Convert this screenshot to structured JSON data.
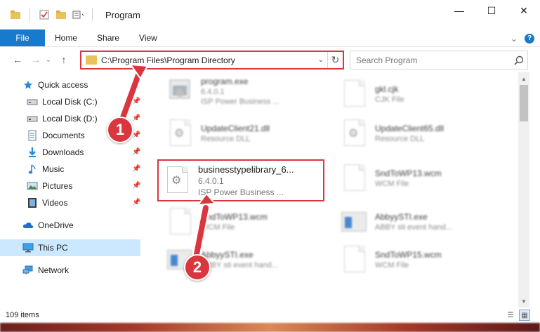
{
  "window": {
    "title": "Program",
    "minimize": "—",
    "maximize": "☐",
    "close": "✕"
  },
  "ribbon": {
    "tabs": [
      "File",
      "Home",
      "Share",
      "View"
    ],
    "help": "?",
    "collapse": "⌄"
  },
  "nav": {
    "back": "←",
    "forward": "→",
    "recent": "⌄",
    "up": "↑",
    "address": "C:\\Program Files\\Program Directory",
    "address_drop": "⌄",
    "refresh": "↻",
    "search_placeholder": "Search Program"
  },
  "sidebar": {
    "items": [
      {
        "label": "Quick access",
        "icon": "star-icon",
        "pin": false
      },
      {
        "label": "Local Disk (C:)",
        "icon": "drive-icon",
        "pin": true
      },
      {
        "label": "Local Disk (D:)",
        "icon": "drive-icon",
        "pin": true
      },
      {
        "label": "Documents",
        "icon": "documents-icon",
        "pin": true
      },
      {
        "label": "Downloads",
        "icon": "download-icon",
        "pin": true
      },
      {
        "label": "Music",
        "icon": "music-icon",
        "pin": true
      },
      {
        "label": "Pictures",
        "icon": "pictures-icon",
        "pin": true
      },
      {
        "label": "Videos",
        "icon": "videos-icon",
        "pin": true
      },
      {
        "label": "OneDrive",
        "icon": "cloud-icon",
        "pin": false
      },
      {
        "label": "This PC",
        "icon": "computer-icon",
        "pin": false,
        "selected": true
      },
      {
        "label": "Network",
        "icon": "network-icon",
        "pin": false
      }
    ]
  },
  "files": [
    {
      "name": "program.exe",
      "line2": "6.4.0.1",
      "line3": "ISP Power Business ...",
      "icon": "exe-icon"
    },
    {
      "name": "gkl.cjk",
      "line2": "CJK File",
      "line3": "",
      "icon": "file-icon"
    },
    {
      "name": "UpdateClient21.dll",
      "line2": "Resource DLL",
      "line3": "",
      "icon": "gear-file-icon"
    },
    {
      "name": "UpdateClient65.dll",
      "line2": "Resource DLL",
      "line3": "",
      "icon": "gear-file-icon"
    },
    {
      "name": "businesstypelibrary_6...",
      "line2": "6.4.0.1",
      "line3": "ISP Power Business ...",
      "icon": "gear-file-icon"
    },
    {
      "name": "SndToWP13.wcm",
      "line2": "WCM File",
      "line3": "",
      "icon": "file-icon"
    },
    {
      "name": "SndToWP13.wcm",
      "line2": "WCM File",
      "line3": "",
      "icon": "file-icon"
    },
    {
      "name": "AbbyySTI.exe",
      "line2": "ABBY sti event hand...",
      "line3": "",
      "icon": "window-app-icon"
    },
    {
      "name": "AbbyySTI.exe",
      "line2": "ABBY sti event hand...",
      "line3": "",
      "icon": "window-app-icon"
    },
    {
      "name": "SndToWP15.wcm",
      "line2": "WCM File",
      "line3": "",
      "icon": "file-icon"
    }
  ],
  "status": {
    "count": "109 items"
  },
  "callouts": [
    "1",
    "2"
  ],
  "colors": {
    "accent": "#1979ca",
    "highlight": "#d9363e",
    "selected": "#cce8ff"
  }
}
